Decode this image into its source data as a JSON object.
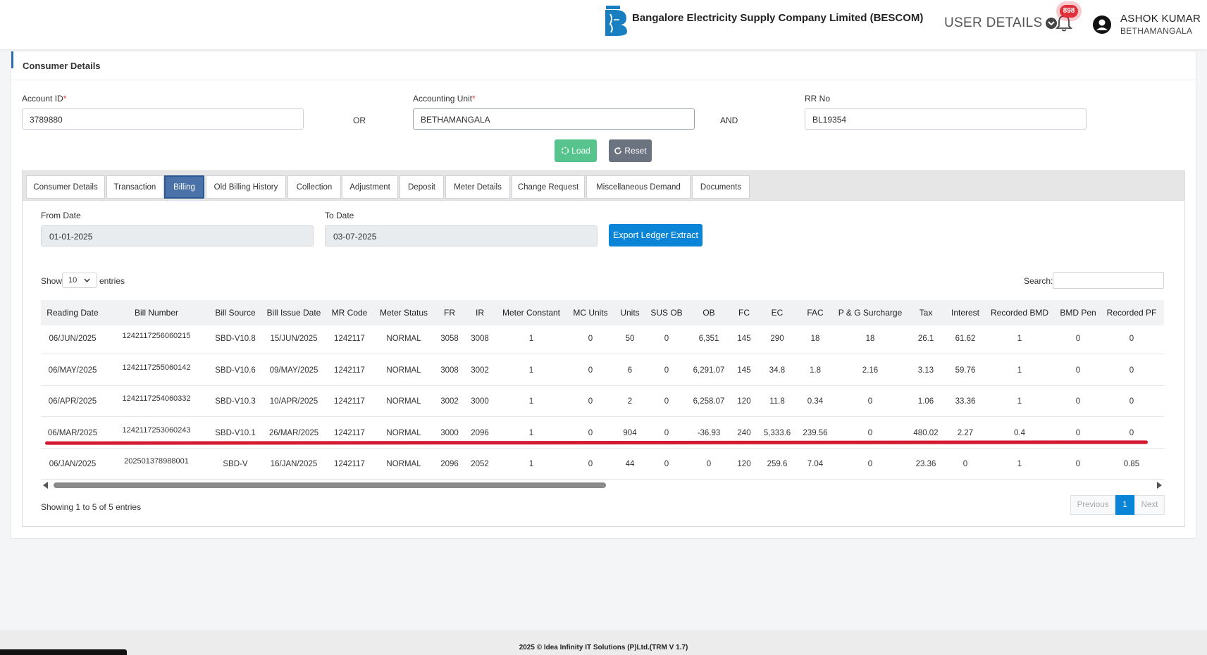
{
  "header": {
    "company": "Bangalore Electricity Supply Company Limited (BESCOM)",
    "logo_text": "BESCOM",
    "user_details_label": "USER DETAILS",
    "notification_count": "898",
    "user_name": "ASHOK KUMAR",
    "user_location": "BETHAMANGALA"
  },
  "consumer": {
    "section_title": "Consumer Details",
    "account_id_label": "Account ID",
    "account_id_value": "3789880",
    "or_label": "OR",
    "accounting_unit_label": "Accounting Unit",
    "accounting_unit_value": "BETHAMANGALA",
    "and_label": "AND",
    "rr_no_label": "RR No",
    "rr_no_value": "BL19354",
    "load_label": "Load",
    "reset_label": "Reset"
  },
  "tabs": [
    {
      "label": "Consumer Details"
    },
    {
      "label": "Transaction"
    },
    {
      "label": "Billing"
    },
    {
      "label": "Old Billing History"
    },
    {
      "label": "Collection"
    },
    {
      "label": "Adjustment"
    },
    {
      "label": "Deposit"
    },
    {
      "label": "Meter Details"
    },
    {
      "label": "Change Request"
    },
    {
      "label": "Miscellaneous Demand"
    },
    {
      "label": "Documents"
    }
  ],
  "active_tab": "Billing",
  "billing": {
    "from_date_label": "From Date",
    "from_date_value": "01-01-2025",
    "to_date_label": "To Date",
    "to_date_value": "03-07-2025",
    "export_label": "Export Ledger Extract",
    "show_label": "Show",
    "entries_label": "entries",
    "page_length": "10",
    "search_label": "Search:",
    "columns": [
      "Reading Date",
      "Bill Number",
      "Bill Source",
      "Bill Issue Date",
      "MR Code",
      "Meter Status",
      "FR",
      "IR",
      "Meter Constant",
      "MC Units",
      "Units",
      "SUS OB",
      "OB",
      "FC",
      "EC",
      "FAC",
      "P & G Surcharge",
      "Tax",
      "Interest",
      "Recorded BMD",
      "BMD Pen",
      "Recorded PF"
    ],
    "rows": [
      [
        "06/JUN/2025",
        "1242117256060215",
        "SBD-V10.8",
        "15/JUN/2025",
        "1242117",
        "NORMAL",
        "3058",
        "3008",
        "1",
        "0",
        "50",
        "0",
        "6,351",
        "145",
        "290",
        "18",
        "18",
        "26.1",
        "61.62",
        "1",
        "0",
        "0"
      ],
      [
        "06/MAY/2025",
        "1242117255060142",
        "SBD-V10.6",
        "09/MAY/2025",
        "1242117",
        "NORMAL",
        "3008",
        "3002",
        "1",
        "0",
        "6",
        "0",
        "6,291.07",
        "145",
        "34.8",
        "1.8",
        "2.16",
        "3.13",
        "59.76",
        "1",
        "0",
        "0"
      ],
      [
        "06/APR/2025",
        "1242117254060332",
        "SBD-V10.3",
        "10/APR/2025",
        "1242117",
        "NORMAL",
        "3002",
        "3000",
        "1",
        "0",
        "2",
        "0",
        "6,258.07",
        "120",
        "11.8",
        "0.34",
        "0",
        "1.06",
        "33.36",
        "1",
        "0",
        "0"
      ],
      [
        "06/MAR/2025",
        "1242117253060243",
        "SBD-V10.1",
        "26/MAR/2025",
        "1242117",
        "NORMAL",
        "3000",
        "2096",
        "1",
        "0",
        "904",
        "0",
        "-36.93",
        "240",
        "5,333.6",
        "239.56",
        "0",
        "480.02",
        "2.27",
        "0.4",
        "0",
        "0"
      ],
      [
        "06/JAN/2025",
        "202501378988001",
        "SBD-V",
        "16/JAN/2025",
        "1242117",
        "NORMAL",
        "2096",
        "2052",
        "1",
        "0",
        "44",
        "0",
        "0",
        "120",
        "259.6",
        "7.04",
        "0",
        "23.36",
        "0",
        "1",
        "0",
        "0.85"
      ]
    ],
    "info_text": "Showing 1 to 5 of 5 entries",
    "previous_label": "Previous",
    "current_page": "1",
    "next_label": "Next"
  },
  "footer": {
    "text": "2025 © Idea Infinity IT Solutions (P)Ltd.(TRM V 1.7)"
  },
  "colors": {
    "accent_blue": "#0a84d6",
    "active_tab": "#4a72a8",
    "load_green": "#56c48c",
    "highlight_red": "#d41a32"
  }
}
